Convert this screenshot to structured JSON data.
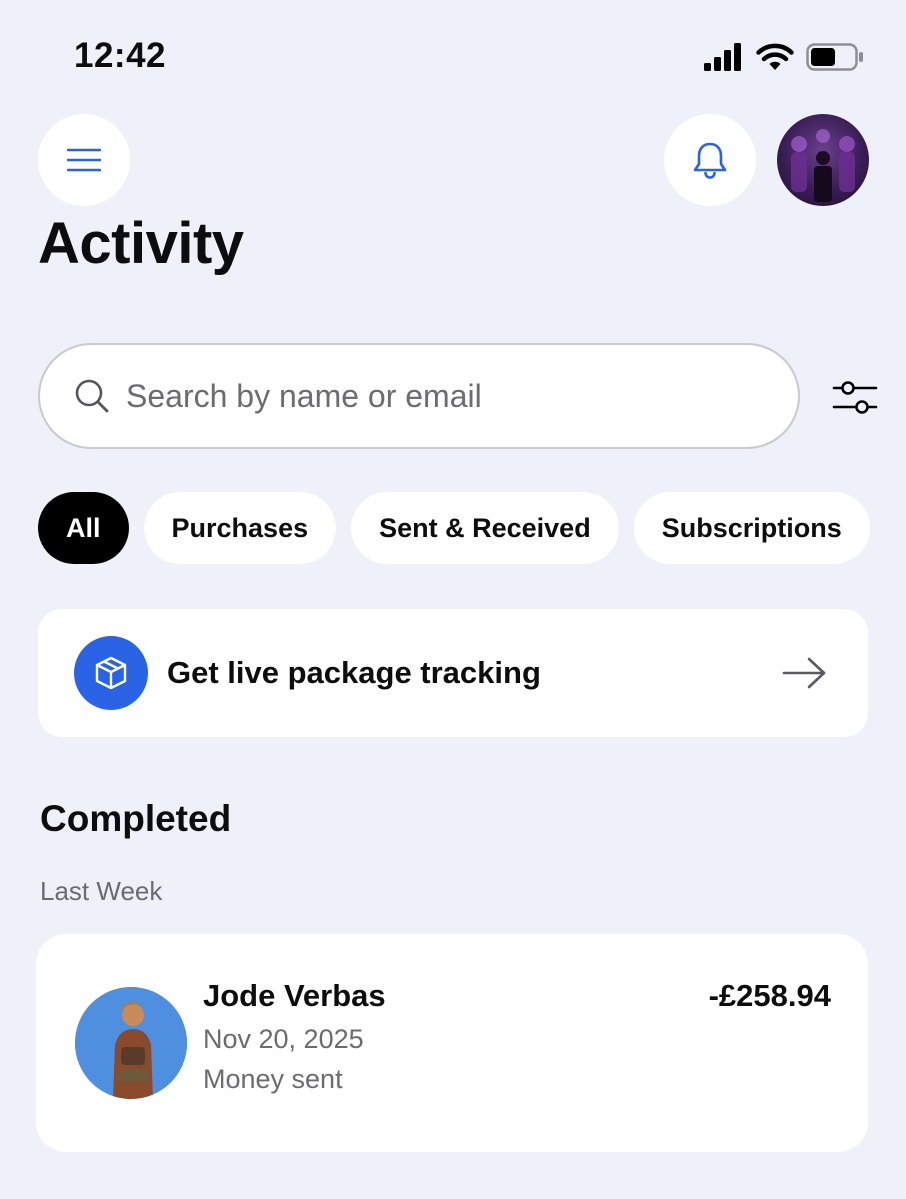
{
  "status_bar": {
    "time": "12:42"
  },
  "header": {
    "menu_icon": "hamburger-menu-icon",
    "notification_icon": "bell-icon",
    "profile_avatar": "profile-avatar"
  },
  "page": {
    "title": "Activity"
  },
  "search": {
    "placeholder": "Search by name or email",
    "value": ""
  },
  "filters": {
    "chips": [
      {
        "label": "All",
        "active": true
      },
      {
        "label": "Purchases",
        "active": false
      },
      {
        "label": "Sent & Received",
        "active": false
      },
      {
        "label": "Subscriptions",
        "active": false
      }
    ]
  },
  "tracking_card": {
    "label": "Get live package tracking",
    "icon": "package-icon"
  },
  "section": {
    "title": "Completed",
    "group": "Last Week"
  },
  "transactions": [
    {
      "name": "Jode Verbas",
      "date": "Nov 20, 2025",
      "status": "Money sent",
      "amount": "-£258.94"
    }
  ],
  "colors": {
    "background": "#eef1f9",
    "accent": "#2a63e6",
    "active_chip": "#000000"
  }
}
